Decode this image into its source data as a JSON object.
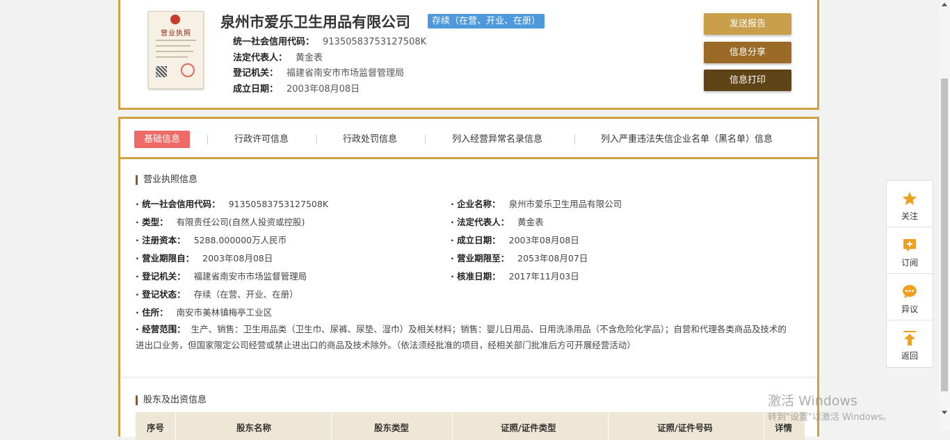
{
  "company": {
    "name": "泉州市爱乐卫生用品有限公司",
    "status": "存续（在营、开业、在册）",
    "license_image_title": "营业执照",
    "summary": [
      {
        "label": "统一社会信用代码：",
        "value": "91350583753127508K"
      },
      {
        "label": "法定代表人：",
        "value": "黄金表"
      },
      {
        "label": "登记机关：",
        "value": "福建省南安市市场监督管理局"
      },
      {
        "label": "成立日期：",
        "value": "2003年08月08日"
      }
    ]
  },
  "actions": {
    "send_report": "发送报告",
    "share": "信息分享",
    "print": "信息打印"
  },
  "tabs": [
    {
      "label": "基础信息",
      "active": true
    },
    {
      "label": "行政许可信息",
      "active": false
    },
    {
      "label": "行政处罚信息",
      "active": false
    },
    {
      "label": "列入经营异常名录信息",
      "active": false
    },
    {
      "label": "列入严重违法失信企业名单（黑名单）信息",
      "active": false
    }
  ],
  "business_license": {
    "title": "营业执照信息",
    "left": [
      {
        "label": "统一社会信用代码：",
        "value": "91350583753127508K"
      },
      {
        "label": "类型：",
        "value": "有限责任公司(自然人投资或控股)"
      },
      {
        "label": "注册资本：",
        "value": "5288.000000万人民币"
      },
      {
        "label": "营业期限自：",
        "value": "2003年08月08日"
      },
      {
        "label": "登记机关：",
        "value": "福建省南安市市场监督管理局"
      },
      {
        "label": "登记状态：",
        "value": "存续（在营、开业、在册）"
      },
      {
        "label": "住所：",
        "value": "南安市美林镇梅亭工业区"
      }
    ],
    "right": [
      {
        "label": "企业名称：",
        "value": "泉州市爱乐卫生用品有限公司"
      },
      {
        "label": "法定代表人：",
        "value": "黄金表"
      },
      {
        "label": "成立日期：",
        "value": "2003年08月08日"
      },
      {
        "label": "营业期限至：",
        "value": "2053年08月07日"
      },
      {
        "label": "核准日期：",
        "value": "2017年11月03日"
      }
    ],
    "scope_label": "经营范围：",
    "scope_value": "生产、销售：卫生用品类（卫生巾、尿裤、尿垫、湿巾）及相关材料；销售：婴儿日用品、日用洗涤用品（不含危险化学品）；自营和代理各类商品及技术的进出口业务，但国家限定公司经营或禁止进出口的商品及技术除外。（依法须经批准的项目，经相关部门批准后方可开展经营活动）"
  },
  "shareholders": {
    "title": "股东及出资信息",
    "columns": [
      "序号",
      "股东名称",
      "股东类型",
      "证照/证件类型",
      "证照/证件号码",
      "详情"
    ]
  },
  "side_panel": [
    {
      "label": "关注",
      "icon": "star-icon"
    },
    {
      "label": "订阅",
      "icon": "subscribe-plus-icon"
    },
    {
      "label": "异议",
      "icon": "chat-bubble-icon"
    },
    {
      "label": "返回",
      "icon": "arrow-up-icon"
    }
  ],
  "watermark": {
    "line1": "激活 Windows",
    "line2": "转到\"设置\"以激活 Windows。"
  },
  "colors": {
    "gold_border": "#d0a23f",
    "active_tab": "#ef6a67",
    "status_badge": "#4e98dc",
    "btn_send": "#c9a049",
    "btn_share": "#9c6a27",
    "btn_print": "#5f4418"
  }
}
